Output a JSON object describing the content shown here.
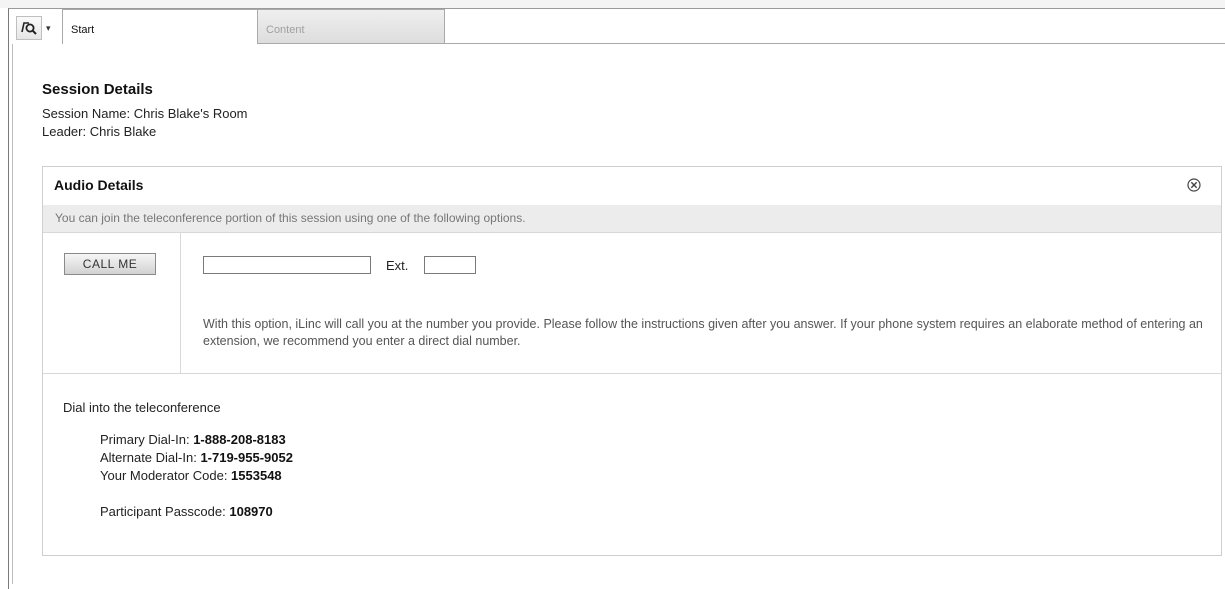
{
  "toolbar": {
    "menu_icon": "presentation-search-icon",
    "menu_chevron": "▾"
  },
  "tabs": [
    {
      "label": "Start",
      "active": true
    },
    {
      "label": "Content",
      "active": false
    }
  ],
  "session": {
    "title": "Session Details",
    "name_line": "Session Name: Chris Blake's Room",
    "leader_line": "Leader: Chris Blake"
  },
  "audio": {
    "title": "Audio Details",
    "close_icon": "close-circle-icon",
    "info": "You can join the teleconference portion of this session using one of the following options.",
    "call_me": {
      "button_label": "CALL ME",
      "phone_value": "",
      "ext_label": "Ext.",
      "ext_value": "",
      "description": "With this option, iLinc will call you at the number you provide. Please follow the instructions given after you answer. If your phone system requires an elaborate method of entering an extension, we recommend you enter a direct dial number."
    },
    "dial_in": {
      "heading": "Dial into the teleconference",
      "primary_label": "Primary Dial-In: ",
      "primary_value": "1-888-208-8183",
      "alternate_label": "Alternate Dial-In: ",
      "alternate_value": "1-719-955-9052",
      "moderator_label": "Your Moderator Code: ",
      "moderator_value": "1553548",
      "participant_label": "Participant Passcode: ",
      "participant_value": "108970"
    }
  },
  "colors": {
    "info_bar": "#ececec",
    "border": "#cfcfcf",
    "muted_text": "#777777"
  }
}
